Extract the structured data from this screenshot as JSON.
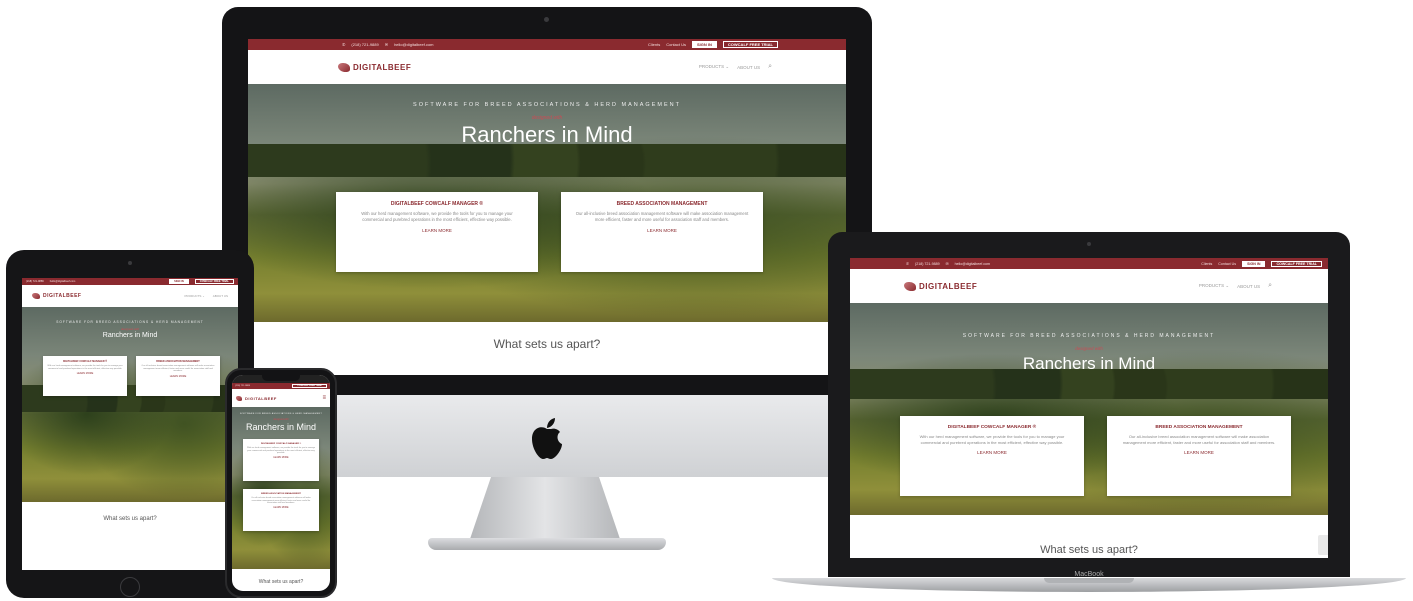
{
  "site": {
    "phone": "(218) 721-9889",
    "email": "hello@digitalbeef.com",
    "top_links": [
      "Clients",
      "Contact Us"
    ],
    "sign_in": "SIGN IN",
    "trial": "COWCALF FREE TRIAL",
    "logo_text": "DIGITALBEEF",
    "nav": [
      "PRODUCTS ⌄",
      "ABOUT US"
    ],
    "tagline": "SOFTWARE FOR BREED ASSOCIATIONS & HERD MANAGEMENT",
    "designed": "designed with",
    "headline": "Ranchers in Mind",
    "cards": [
      {
        "title": "DIGITALBEEF COWCALF MANAGER ®",
        "body": "With our herd management software, we provide the tools for you to manage your commercial and purebred operations in the most efficient, effective way possible.",
        "link": "LEARN MORE"
      },
      {
        "title": "BREED ASSOCIATION MANAGEMENT",
        "body": "Our all-inclusive breed association management software will make association management more efficient, faster and more useful for association staff and members.",
        "link": "LEARN MORE"
      }
    ],
    "apart": "What sets us apart?"
  },
  "devices": {
    "laptop_label": "MacBook"
  },
  "colors": {
    "brand": "#8a2a2f",
    "device_frame": "#1c1c1e",
    "stand": "#c9cbce"
  },
  "icons": [
    "apple-logo-icon",
    "search-icon",
    "phone-icon",
    "email-icon",
    "recaptcha-icon",
    "camera-icon"
  ]
}
